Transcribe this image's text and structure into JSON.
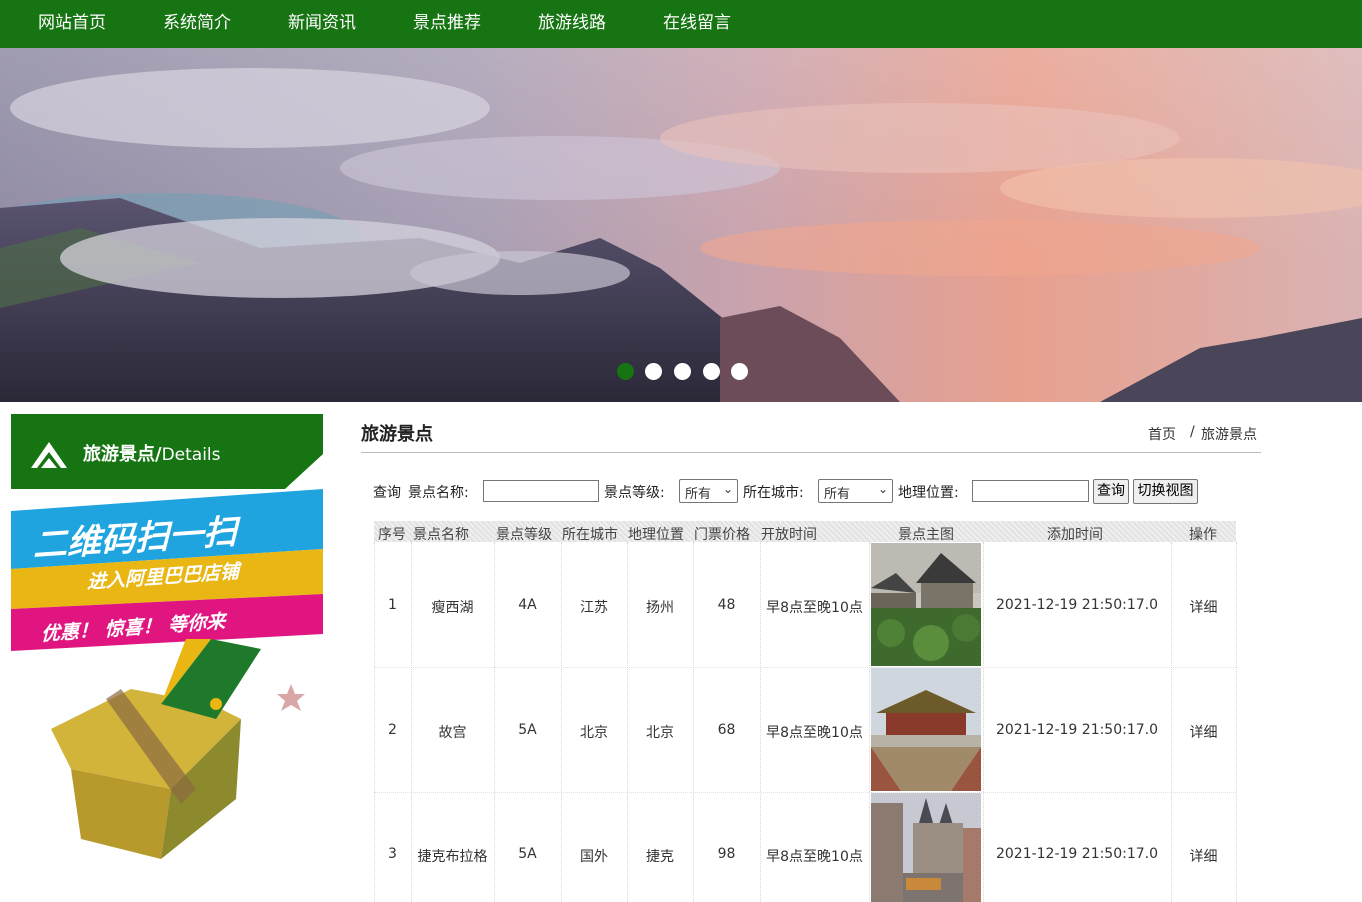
{
  "nav": {
    "items": [
      "网站首页",
      "系统简介",
      "新闻资讯",
      "景点推荐",
      "旅游线路",
      "在线留言"
    ]
  },
  "colors": {
    "brand_green": "#167412"
  },
  "banner": {
    "slide_count": 5,
    "active_slide": 1
  },
  "sidebar": {
    "title": "旅游景点/",
    "subtitle": "Details",
    "promo": {
      "line1": "二维码扫一扫",
      "line2": "进入阿里巴巴店铺",
      "line3": "优惠！ 惊喜！ 等你来"
    }
  },
  "main": {
    "title": "旅游景点",
    "breadcrumb": {
      "home": "首页",
      "sep": "/",
      "current": "旅游景点"
    }
  },
  "search": {
    "query_label": "查询",
    "name_label": "景点名称:",
    "name_value": "",
    "level_label": "景点等级:",
    "level_selected": "所有",
    "city_label": "所在城市:",
    "city_selected": "所有",
    "location_label": "地理位置:",
    "location_value": "",
    "search_button": "查询",
    "switch_view_button": "切换视图"
  },
  "table": {
    "headers": [
      "序号",
      "景点名称",
      "景点等级",
      "所在城市",
      "地理位置",
      "门票价格",
      "开放时间",
      "景点主图",
      "添加时间",
      "操作"
    ],
    "rows": [
      {
        "no": "1",
        "name": "瘦西湖",
        "level": "4A",
        "city": "江苏",
        "location": "扬州",
        "price": "48",
        "hours": "早8点至晚10点",
        "image": "garden-pavilion-photo",
        "added": "2021-12-19 21:50:17.0",
        "action": "详细"
      },
      {
        "no": "2",
        "name": "故宫",
        "level": "5A",
        "city": "北京",
        "location": "北京",
        "price": "68",
        "hours": "早8点至晚10点",
        "image": "palace-hall-photo",
        "added": "2021-12-19 21:50:17.0",
        "action": "详细"
      },
      {
        "no": "3",
        "name": "捷克布拉格",
        "level": "5A",
        "city": "国外",
        "location": "捷克",
        "price": "98",
        "hours": "早8点至晚10点",
        "image": "prague-street-photo",
        "added": "2021-12-19 21:50:17.0",
        "action": "详细"
      }
    ]
  }
}
